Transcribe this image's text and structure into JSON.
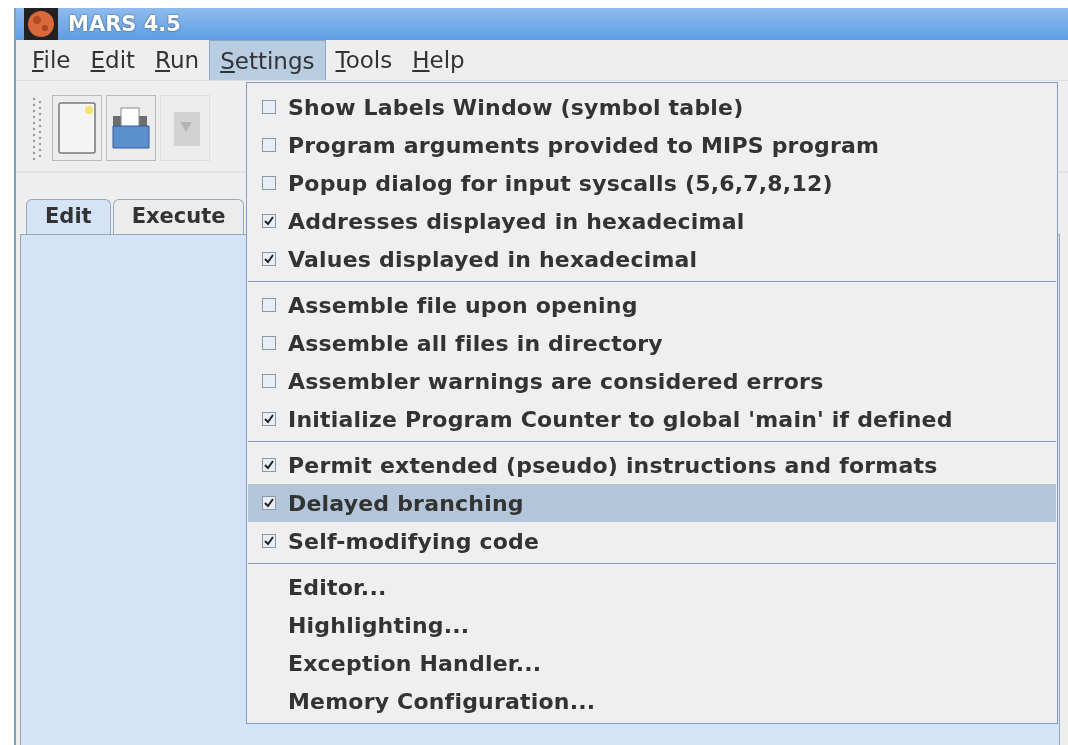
{
  "window": {
    "title": "MARS 4.5"
  },
  "menu_bar": [
    {
      "label": "File",
      "selected": false
    },
    {
      "label": "Edit",
      "selected": false
    },
    {
      "label": "Run",
      "selected": false
    },
    {
      "label": "Settings",
      "selected": true
    },
    {
      "label": "Tools",
      "selected": false
    },
    {
      "label": "Help",
      "selected": false
    }
  ],
  "tabs": [
    {
      "label": "Edit",
      "selected": true
    },
    {
      "label": "Execute",
      "selected": false
    }
  ],
  "settings_menu": [
    [
      {
        "kind": "checkbox",
        "label": "Show Labels Window (symbol table)",
        "checked": false,
        "selected": false
      },
      {
        "kind": "checkbox",
        "label": "Program arguments provided to MIPS program",
        "checked": false,
        "selected": false
      },
      {
        "kind": "checkbox",
        "label": "Popup dialog for input syscalls (5,6,7,8,12)",
        "checked": false,
        "selected": false
      },
      {
        "kind": "checkbox",
        "label": "Addresses displayed in hexadecimal",
        "checked": true,
        "selected": false
      },
      {
        "kind": "checkbox",
        "label": "Values displayed in hexadecimal",
        "checked": true,
        "selected": false
      }
    ],
    [
      {
        "kind": "checkbox",
        "label": "Assemble file upon opening",
        "checked": false,
        "selected": false
      },
      {
        "kind": "checkbox",
        "label": "Assemble all files in directory",
        "checked": false,
        "selected": false
      },
      {
        "kind": "checkbox",
        "label": "Assembler warnings are considered errors",
        "checked": false,
        "selected": false
      },
      {
        "kind": "checkbox",
        "label": "Initialize Program Counter to global 'main' if defined",
        "checked": true,
        "selected": false
      }
    ],
    [
      {
        "kind": "checkbox",
        "label": "Permit extended (pseudo) instructions and formats",
        "checked": true,
        "selected": false
      },
      {
        "kind": "checkbox",
        "label": "Delayed branching",
        "checked": true,
        "selected": true
      },
      {
        "kind": "checkbox",
        "label": "Self-modifying code",
        "checked": true,
        "selected": false
      }
    ],
    [
      {
        "kind": "action",
        "label": "Editor...",
        "selected": false
      },
      {
        "kind": "action",
        "label": "Highlighting...",
        "selected": false
      },
      {
        "kind": "action",
        "label": "Exception Handler...",
        "selected": false
      },
      {
        "kind": "action",
        "label": "Memory Configuration...",
        "selected": false
      }
    ]
  ]
}
